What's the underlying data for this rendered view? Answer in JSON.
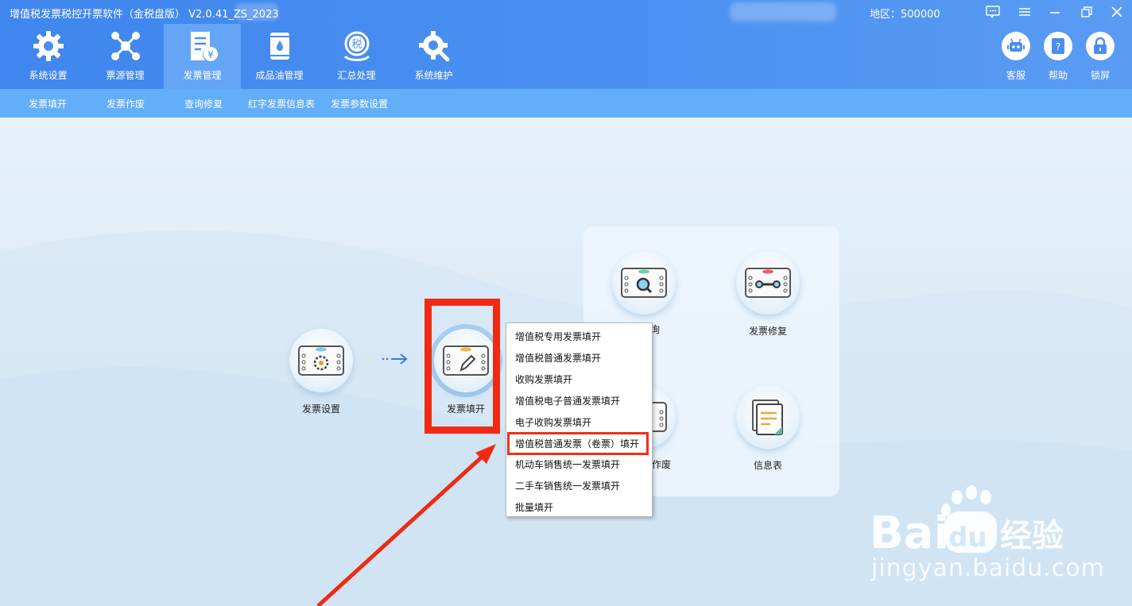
{
  "titlebar": {
    "app_title": "增值税发票税控开票软件（金税盘版） V2.0.41_ZS_2023",
    "region": "地区：500000"
  },
  "modules": [
    {
      "label": "系统设置",
      "icon": "gear-icon"
    },
    {
      "label": "票源管理",
      "icon": "network-icon"
    },
    {
      "label": "发票管理",
      "icon": "invoice-icon",
      "active": true
    },
    {
      "label": "成品油管理",
      "icon": "oil-barrel-icon"
    },
    {
      "label": "汇总处理",
      "icon": "tax-summary-icon"
    },
    {
      "label": "系统维护",
      "icon": "maintenance-icon"
    }
  ],
  "right_tools": [
    {
      "label": "客服",
      "icon": "robot-icon"
    },
    {
      "label": "帮助",
      "icon": "help-book-icon"
    },
    {
      "label": "锁屏",
      "icon": "lock-icon"
    }
  ],
  "subnav": [
    "发票填开",
    "发票作废",
    "查询修复",
    "红字发票信息表",
    "发票参数设置"
  ],
  "flow": {
    "setup_label": "发票设置",
    "fill_label": "发票填开",
    "query_label": "查询",
    "query_label_visible": "询",
    "repair_label": "发票修复",
    "void_label_visible": "作废",
    "info_label": "信息表"
  },
  "menu": [
    "增值税专用发票填开",
    "增值税普通发票填开",
    "收购发票填开",
    "增值税电子普通发票填开",
    "电子收购发票填开",
    "增值税普通发票（卷票）填开",
    "机动车销售统一发票填开",
    "二手车销售统一发票填开",
    "批量填开"
  ],
  "watermark": {
    "brand": "Bai  du 经验",
    "url": "jingyan.baidu.com"
  },
  "colors": {
    "header": "#4c91f1",
    "subnav": "#63aef8",
    "highlight_red": "#ee2b12"
  }
}
